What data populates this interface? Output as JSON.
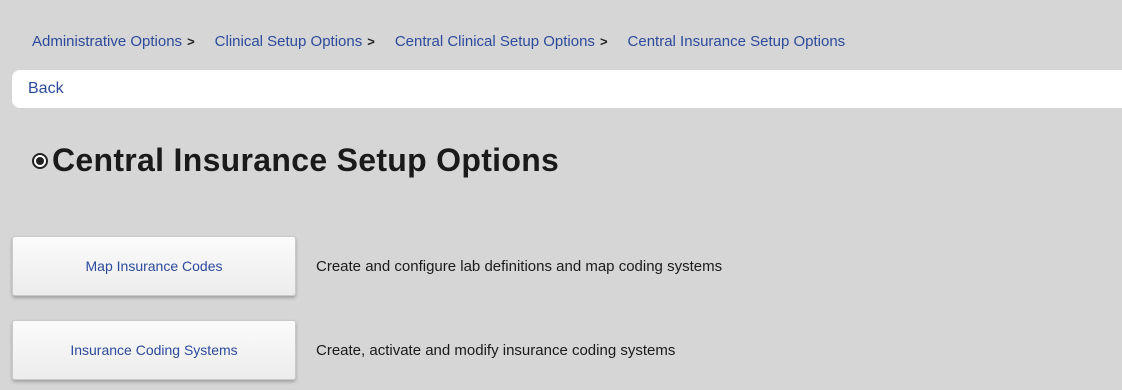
{
  "breadcrumb": {
    "items": [
      {
        "label": "Administrative Options",
        "separator": ">"
      },
      {
        "label": "Clinical Setup Options",
        "separator": ">"
      },
      {
        "label": "Central Clinical Setup Options",
        "separator": ">"
      },
      {
        "label": "Central Insurance Setup Options",
        "separator": ""
      }
    ]
  },
  "nav": {
    "back_label": "Back"
  },
  "page": {
    "title": "Central Insurance Setup Options"
  },
  "options": [
    {
      "button_label": "Map Insurance Codes",
      "description": "Create and configure lab definitions and map coding systems"
    },
    {
      "button_label": "Insurance Coding Systems",
      "description": "Create, activate and modify insurance coding systems"
    }
  ],
  "colors": {
    "link": "#2c4a9c",
    "background": "#d6d6d6",
    "text": "#1a1a1a"
  },
  "icons": {
    "title_icon": "radio-selected-icon"
  }
}
